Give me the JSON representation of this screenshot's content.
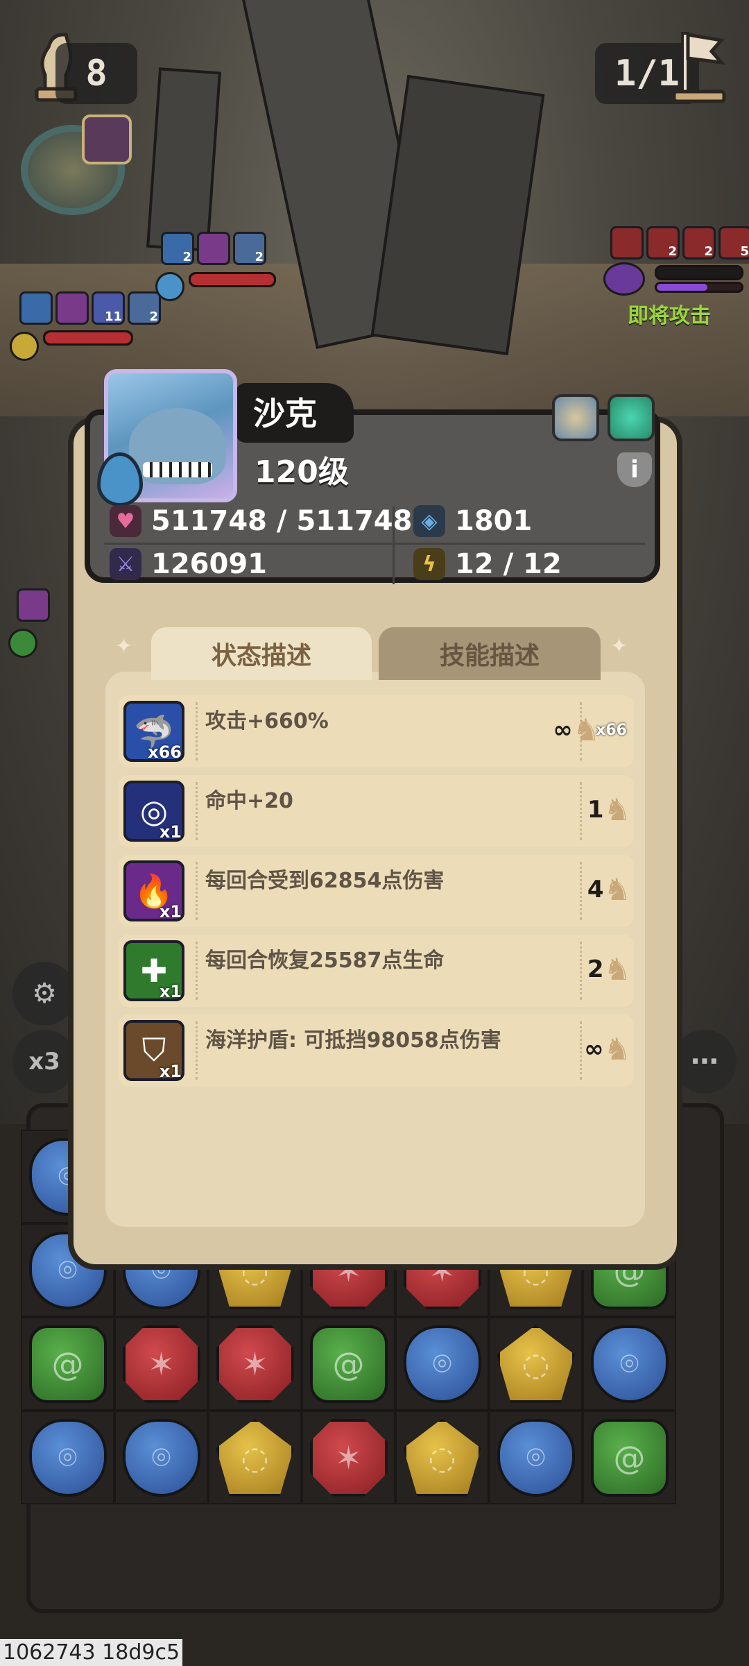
{
  "hud": {
    "turns": "8",
    "wave": "1/1",
    "attack_warning": "即将攻击",
    "speed_label": "x3"
  },
  "field": {
    "ally_top_buff_counts": [
      "2",
      "",
      "2"
    ],
    "ally_mid_buff_counts": [
      "",
      "",
      "11",
      "2"
    ],
    "enemy_buff_counts": [
      "",
      "2",
      "2",
      "5"
    ]
  },
  "hero": {
    "name": "沙克",
    "level": "120级",
    "hp": "511748 / 511748",
    "defense": "1801",
    "attack": "126091",
    "energy": "12 / 12"
  },
  "tabs": {
    "status": "状态描述",
    "skill": "技能描述"
  },
  "statuses": [
    {
      "text": "攻击+660%",
      "stack": "x66",
      "duration": "∞",
      "duration_extra": "x66",
      "color": "#2a4fa8",
      "icon": "shark-icon"
    },
    {
      "text": "命中+20",
      "stack": "x1",
      "duration": "1",
      "duration_extra": "",
      "color": "#24307a",
      "icon": "target-icon"
    },
    {
      "text": "每回合受到62854点伤害",
      "stack": "x1",
      "duration": "4",
      "duration_extra": "",
      "color": "#6a2a8a",
      "icon": "flame-icon"
    },
    {
      "text": "每回合恢复25587点生命",
      "stack": "x1",
      "duration": "2",
      "duration_extra": "",
      "color": "#2f7a2c",
      "icon": "heal-cross-icon"
    },
    {
      "text": "海洋护盾: 可抵挡98058点伤害",
      "stack": "x1",
      "duration": "∞",
      "duration_extra": "",
      "color": "#6a4a2a",
      "icon": "shield-icon"
    }
  ],
  "gems": [
    [
      "blue",
      "blue",
      "yellow",
      "red",
      "red",
      "yellow",
      "green"
    ],
    [
      "green",
      "red",
      "red",
      "green",
      "blue",
      "yellow",
      "blue"
    ],
    [
      "blue",
      "blue",
      "yellow",
      "red",
      "yellow",
      "blue",
      "green"
    ]
  ],
  "debug_text": "1062743 18d9c5"
}
